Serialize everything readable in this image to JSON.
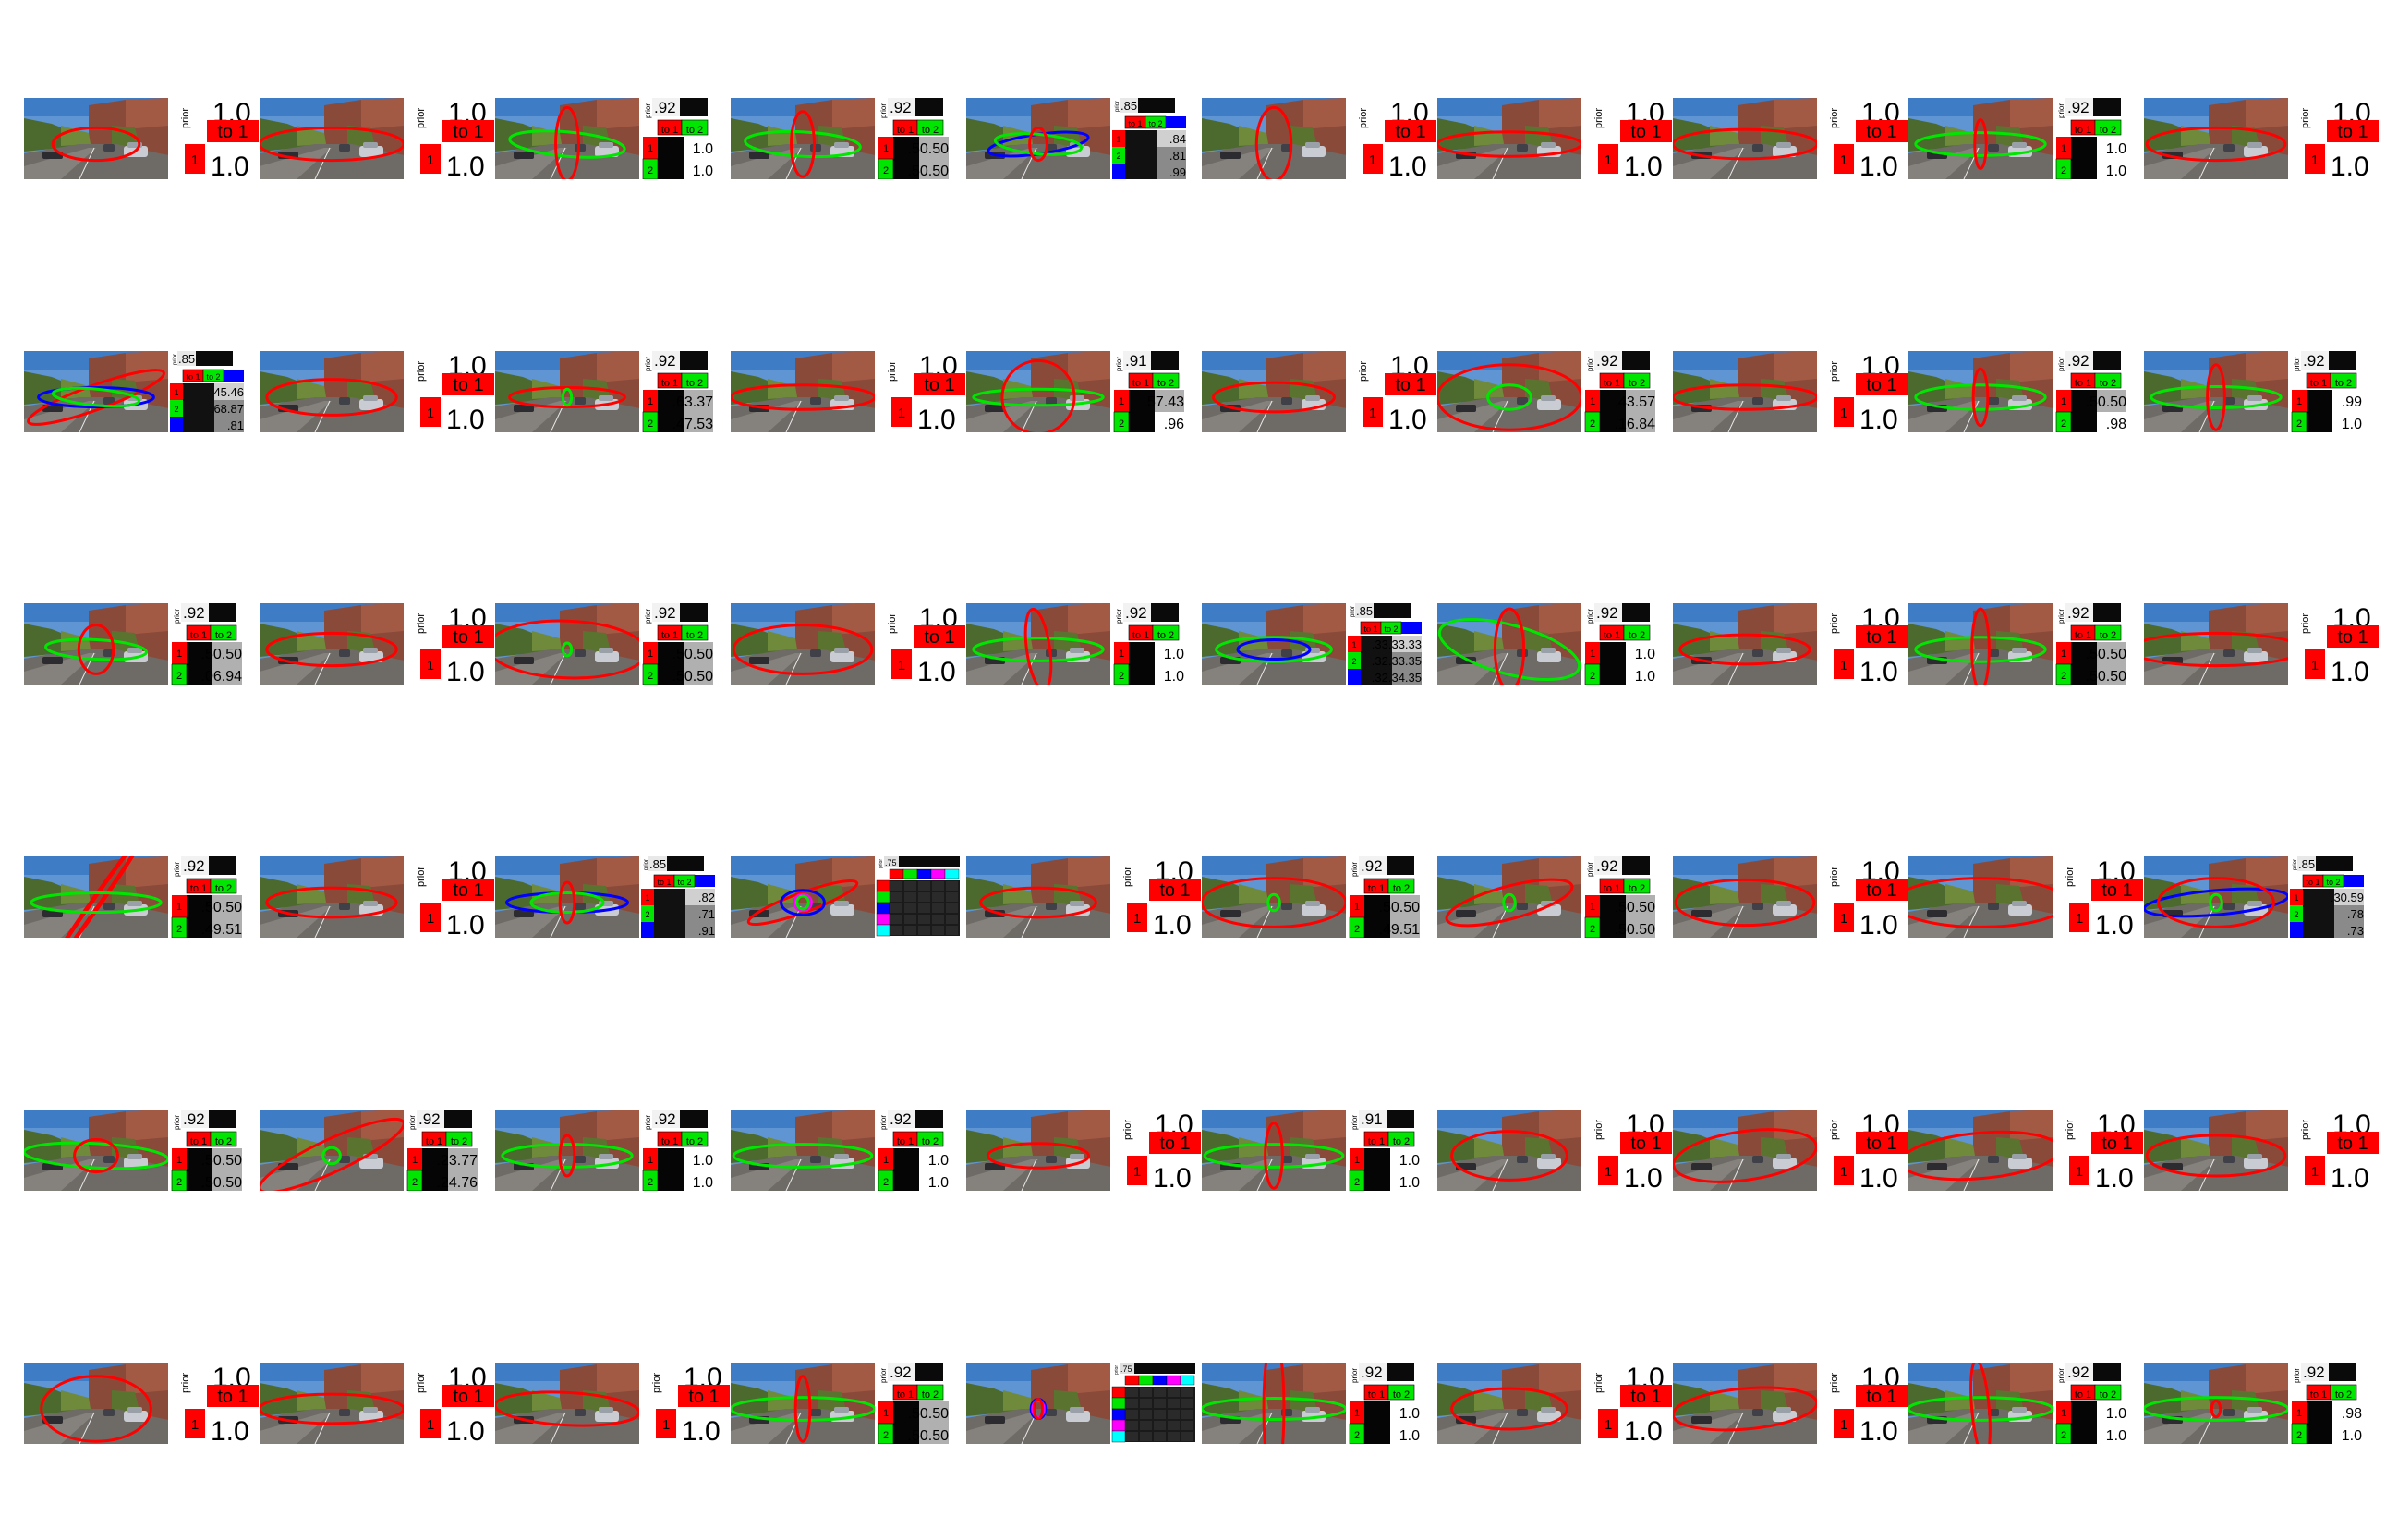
{
  "labels": {
    "prior": "prior",
    "to1": "to 1",
    "to2": "to 2",
    "one": "1",
    "two": "2"
  },
  "colors": {
    "red": "#ff0000",
    "green": "#00e600",
    "blue": "#0000ff",
    "magenta": "#ff00ff",
    "cyan": "#00ffff",
    "sky": "#5f95d2",
    "road": "#6e6a66"
  },
  "tiles": [
    {
      "type": "A",
      "ov": [
        [
          "red",
          0.3,
          0.2,
          0
        ]
      ]
    },
    {
      "type": "A",
      "ov": [
        [
          "red",
          0.5,
          0.2,
          0
        ]
      ]
    },
    {
      "type": "B",
      "prior": ".92",
      "cells": [
        "1.0",
        "1.0"
      ],
      "ov": [
        [
          "green",
          0.4,
          0.15,
          -5
        ],
        [
          "red",
          0.08,
          0.45,
          0
        ]
      ]
    },
    {
      "type": "B",
      "prior": ".92",
      "cells": [
        ".50.50",
        ".50.50"
      ],
      "ov": [
        [
          "green",
          0.4,
          0.15,
          -3
        ],
        [
          "red",
          0.08,
          0.4,
          0
        ]
      ]
    },
    {
      "type": "C",
      "prior": ".85",
      "rows": [
        ".84",
        ".81",
        ".99"
      ],
      "ov": [
        [
          "blue",
          0.35,
          0.12,
          8
        ],
        [
          "green",
          0.3,
          0.12,
          -5
        ],
        [
          "red",
          0.06,
          0.2,
          0
        ]
      ]
    },
    {
      "type": "A",
      "ov": [
        [
          "red",
          0.12,
          0.45,
          0
        ]
      ]
    },
    {
      "type": "A",
      "ov": [
        [
          "red",
          0.5,
          0.15,
          0
        ]
      ]
    },
    {
      "type": "A",
      "ov": [
        [
          "red",
          0.5,
          0.18,
          0
        ]
      ]
    },
    {
      "type": "B",
      "prior": ".92",
      "cells": [
        "1.0",
        "1.0"
      ],
      "ov": [
        [
          "green",
          0.45,
          0.14,
          0
        ],
        [
          "red",
          0.04,
          0.3,
          0
        ]
      ]
    },
    {
      "type": "A",
      "ov": [
        [
          "red",
          0.48,
          0.2,
          0
        ]
      ]
    },
    {
      "type": "C",
      "prior": ".85",
      "rows": [
        ".45.46",
        ".68.87",
        ".81"
      ],
      "ov": [
        [
          "red",
          0.5,
          0.15,
          20
        ],
        [
          "blue",
          0.4,
          0.12,
          0
        ],
        [
          "green",
          0.3,
          0.1,
          -5
        ]
      ]
    },
    {
      "type": "A",
      "ov": [
        [
          "red",
          0.45,
          0.22,
          0
        ]
      ]
    },
    {
      "type": "B",
      "prior": ".92",
      "cells": [
        ".63.37",
        ".47.53"
      ],
      "ov": [
        [
          "red",
          0.4,
          0.12,
          0
        ],
        [
          "green",
          0.03,
          0.1,
          0
        ]
      ]
    },
    {
      "type": "A",
      "ov": [
        [
          "red",
          0.5,
          0.15,
          0
        ]
      ]
    },
    {
      "type": "B",
      "prior": ".91",
      "cells": [
        ".57.43",
        ".96"
      ],
      "ov": [
        [
          "green",
          0.45,
          0.1,
          0
        ],
        [
          "red",
          0.25,
          0.45,
          -8
        ]
      ]
    },
    {
      "type": "A",
      "ov": [
        [
          "red",
          0.42,
          0.18,
          0
        ]
      ]
    },
    {
      "type": "B",
      "prior": ".92",
      "cells": [
        ".43.57",
        ".16.84"
      ],
      "ov": [
        [
          "red",
          0.5,
          0.4,
          0
        ],
        [
          "green",
          0.15,
          0.15,
          0
        ]
      ]
    },
    {
      "type": "A",
      "ov": [
        [
          "red",
          0.5,
          0.15,
          0
        ]
      ]
    },
    {
      "type": "B",
      "prior": ".92",
      "cells": [
        ".50.50",
        ".98"
      ],
      "ov": [
        [
          "green",
          0.45,
          0.15,
          0
        ],
        [
          "red",
          0.05,
          0.35,
          0
        ]
      ]
    },
    {
      "type": "B",
      "prior": ".92",
      "cells": [
        ".99",
        "1.0"
      ],
      "ov": [
        [
          "green",
          0.45,
          0.13,
          0
        ],
        [
          "red",
          0.06,
          0.4,
          0
        ]
      ]
    },
    {
      "type": "B",
      "prior": ".92",
      "cells": [
        ".50.50",
        ".06.94"
      ],
      "ov": [
        [
          "green",
          0.35,
          0.12,
          -3
        ],
        [
          "red",
          0.12,
          0.3,
          0
        ]
      ]
    },
    {
      "type": "A",
      "ov": [
        [
          "red",
          0.45,
          0.2,
          0
        ]
      ]
    },
    {
      "type": "B",
      "prior": ".92",
      "cells": [
        ".50.50",
        ".50.50"
      ],
      "ov": [
        [
          "red",
          0.55,
          0.35,
          -2
        ],
        [
          "green",
          0.03,
          0.08,
          0
        ]
      ]
    },
    {
      "type": "A",
      "ov": [
        [
          "red",
          0.48,
          0.3,
          0
        ]
      ]
    },
    {
      "type": "B",
      "prior": ".92",
      "cells": [
        "1.0",
        "1.0"
      ],
      "ov": [
        [
          "green",
          0.45,
          0.14,
          0
        ],
        [
          "red",
          0.08,
          0.5,
          8
        ]
      ]
    },
    {
      "type": "C",
      "prior": ".85",
      "rows": [
        ".33.33.33",
        ".32.33.35",
        ".32.34.35"
      ],
      "ov": [
        [
          "green",
          0.4,
          0.15,
          0
        ],
        [
          "blue",
          0.25,
          0.12,
          0
        ]
      ]
    },
    {
      "type": "B",
      "prior": ".92",
      "cells": [
        "1.0",
        "1.0"
      ],
      "ov": [
        [
          "green",
          0.5,
          0.3,
          -15
        ],
        [
          "red",
          0.1,
          0.5,
          0
        ]
      ]
    },
    {
      "type": "A",
      "ov": [
        [
          "red",
          0.45,
          0.18,
          0
        ]
      ]
    },
    {
      "type": "B",
      "prior": ".92",
      "cells": [
        ".50.50",
        ".50.50"
      ],
      "ov": [
        [
          "green",
          0.45,
          0.15,
          0
        ],
        [
          "red",
          0.06,
          0.5,
          0
        ]
      ]
    },
    {
      "type": "A",
      "ov": [
        [
          "red",
          0.6,
          0.2,
          0
        ]
      ]
    },
    {
      "type": "B",
      "prior": ".92",
      "cells": [
        ".50.50",
        ".49.51"
      ],
      "ov": [
        [
          "red",
          0.6,
          0.06,
          55
        ],
        [
          "red",
          0.6,
          0.04,
          55
        ],
        [
          "green",
          0.45,
          0.12,
          0
        ]
      ]
    },
    {
      "type": "A",
      "ov": [
        [
          "red",
          0.45,
          0.18,
          0
        ]
      ]
    },
    {
      "type": "C",
      "prior": ".85",
      "rows": [
        ".82",
        ".71",
        ".91"
      ],
      "ov": [
        [
          "blue",
          0.42,
          0.12,
          0
        ],
        [
          "green",
          0.25,
          0.12,
          0
        ],
        [
          "red",
          0.05,
          0.25,
          0
        ]
      ]
    },
    {
      "type": "D",
      "prior": ".75",
      "ov": [
        [
          "red",
          0.4,
          0.12,
          20
        ],
        [
          "blue",
          0.15,
          0.15,
          0
        ],
        [
          "magenta",
          0.06,
          0.1,
          0
        ],
        [
          "green",
          0.04,
          0.08,
          0
        ]
      ]
    },
    {
      "type": "A",
      "ov": [
        [
          "red",
          0.4,
          0.18,
          0
        ]
      ]
    },
    {
      "type": "B",
      "prior": ".92",
      "cells": [
        ".50.50",
        ".49.51"
      ],
      "ov": [
        [
          "red",
          0.5,
          0.3,
          0
        ],
        [
          "green",
          0.04,
          0.1,
          0
        ]
      ]
    },
    {
      "type": "B",
      "prior": ".92",
      "cells": [
        ".50.50",
        ".50.50"
      ],
      "ov": [
        [
          "red",
          0.45,
          0.2,
          15
        ],
        [
          "green",
          0.04,
          0.1,
          0
        ]
      ]
    },
    {
      "type": "A",
      "ov": [
        [
          "red",
          0.48,
          0.28,
          0
        ]
      ]
    },
    {
      "type": "A",
      "ov": [
        [
          "red",
          0.6,
          0.3,
          0
        ]
      ]
    },
    {
      "type": "C",
      "prior": ".85",
      "rows": [
        ".30.59",
        ".78",
        ".73"
      ],
      "ov": [
        [
          "blue",
          0.5,
          0.15,
          5
        ],
        [
          "red",
          0.4,
          0.3,
          0
        ],
        [
          "green",
          0.04,
          0.1,
          0
        ]
      ]
    },
    {
      "type": "B",
      "prior": ".92",
      "cells": [
        ".50.50",
        ".50.50"
      ],
      "ov": [
        [
          "green",
          0.5,
          0.15,
          -3
        ],
        [
          "red",
          0.15,
          0.2,
          0
        ]
      ]
    },
    {
      "type": "B",
      "prior": ".92",
      "cells": [
        ".23.77",
        ".24.76"
      ],
      "ov": [
        [
          "red",
          0.55,
          0.2,
          25
        ],
        [
          "green",
          0.06,
          0.1,
          0
        ]
      ]
    },
    {
      "type": "B",
      "prior": ".92",
      "cells": [
        "1.0",
        "1.0"
      ],
      "ov": [
        [
          "green",
          0.45,
          0.14,
          0
        ],
        [
          "red",
          0.05,
          0.25,
          0
        ]
      ]
    },
    {
      "type": "B",
      "prior": ".92",
      "cells": [
        "1.0",
        "1.0"
      ],
      "ov": [
        [
          "green",
          0.48,
          0.14,
          0
        ]
      ]
    },
    {
      "type": "A",
      "ov": [
        [
          "red",
          0.35,
          0.15,
          0
        ]
      ]
    },
    {
      "type": "B",
      "prior": ".91",
      "cells": [
        "1.0",
        "1.0"
      ],
      "ov": [
        [
          "green",
          0.48,
          0.14,
          0
        ],
        [
          "red",
          0.06,
          0.4,
          0
        ]
      ]
    },
    {
      "type": "A",
      "ov": [
        [
          "red",
          0.4,
          0.3,
          0
        ]
      ]
    },
    {
      "type": "A",
      "ov": [
        [
          "red",
          0.5,
          0.3,
          8
        ]
      ]
    },
    {
      "type": "A",
      "ov": [
        [
          "red",
          0.55,
          0.28,
          5
        ]
      ]
    },
    {
      "type": "A",
      "ov": [
        [
          "red",
          0.48,
          0.25,
          0
        ]
      ]
    },
    {
      "type": "A",
      "ov": [
        [
          "red",
          0.38,
          0.4,
          0
        ]
      ]
    },
    {
      "type": "A",
      "ov": [
        [
          "red",
          0.5,
          0.18,
          0
        ]
      ]
    },
    {
      "type": "A",
      "ov": [
        [
          "red",
          0.5,
          0.2,
          -3
        ]
      ]
    },
    {
      "type": "B",
      "prior": ".92",
      "cells": [
        ".50.50",
        ".50.50"
      ],
      "ov": [
        [
          "green",
          0.5,
          0.14,
          0
        ],
        [
          "red",
          0.05,
          0.4,
          0
        ]
      ]
    },
    {
      "type": "D",
      "prior": ".75",
      "ov": [
        [
          "blue",
          0.05,
          0.12,
          0
        ],
        [
          "magenta",
          0.04,
          0.1,
          0
        ],
        [
          "red",
          0.03,
          0.12,
          0
        ]
      ]
    },
    {
      "type": "B",
      "prior": ".92",
      "cells": [
        "1.0",
        "1.0"
      ],
      "ov": [
        [
          "green",
          0.5,
          0.13,
          0
        ],
        [
          "red",
          0.07,
          0.9,
          0
        ]
      ]
    },
    {
      "type": "A",
      "ov": [
        [
          "red",
          0.4,
          0.25,
          0
        ]
      ]
    },
    {
      "type": "A",
      "ov": [
        [
          "red",
          0.5,
          0.25,
          5
        ]
      ]
    },
    {
      "type": "B",
      "prior": ".92",
      "cells": [
        "1.0",
        "1.0"
      ],
      "ov": [
        [
          "green",
          0.5,
          0.14,
          0
        ],
        [
          "red",
          0.06,
          0.6,
          5
        ]
      ]
    },
    {
      "type": "B",
      "prior": ".92",
      "cells": [
        ".98",
        "1.0"
      ],
      "ov": [
        [
          "green",
          0.5,
          0.14,
          0
        ],
        [
          "red",
          0.03,
          0.1,
          0
        ]
      ]
    }
  ]
}
